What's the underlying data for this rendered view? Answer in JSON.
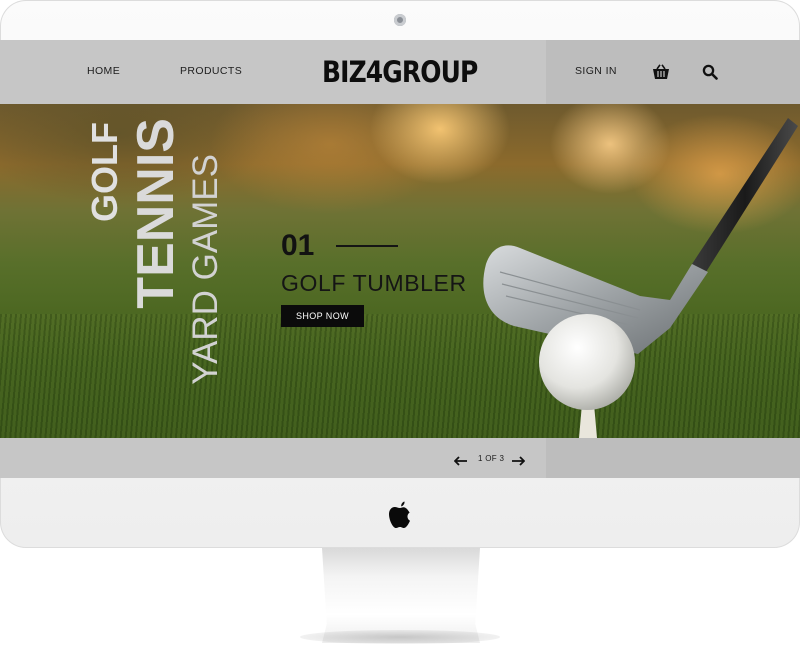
{
  "header": {
    "nav": {
      "home": "HOME",
      "products": "PRODUCTS"
    },
    "logo": "BIZ4GROUP",
    "sign_in": "SIGN IN",
    "icons": {
      "cart": "basket-icon",
      "search": "search-icon"
    }
  },
  "hero": {
    "categories": [
      "GOLF",
      "TENNIS",
      "YARD GAMES"
    ],
    "slide_number": "01",
    "slide_title": "GOLF TUMBLER",
    "cta_label": "SHOP NOW"
  },
  "pager": {
    "label": "1 OF 3",
    "current": 1,
    "total": 3
  },
  "colors": {
    "header_bg": "#c6c6c6",
    "header_panel_bg": "#bdbdbd",
    "text": "#151515",
    "cta_bg": "#0b0b0b",
    "cta_text": "#ffffff",
    "category_text": "#d9d9d9"
  }
}
